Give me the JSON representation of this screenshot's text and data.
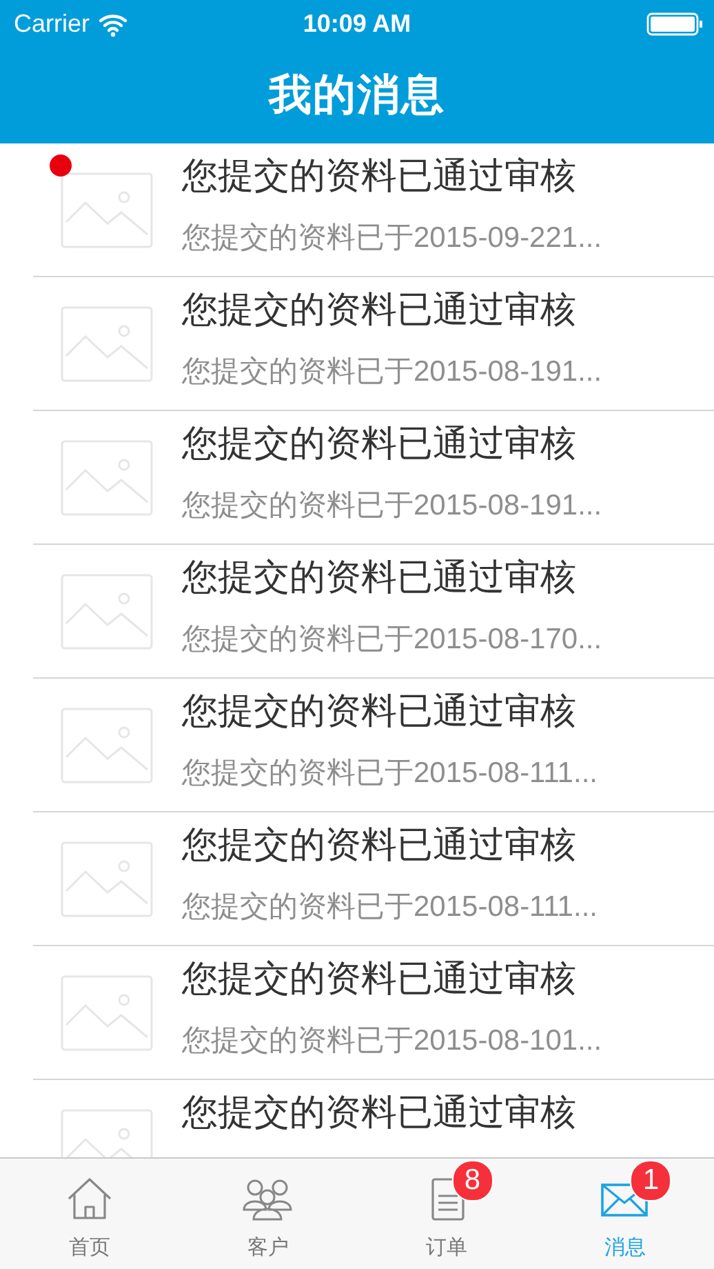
{
  "status_bar": {
    "carrier": "Carrier",
    "time": "10:09 AM"
  },
  "nav": {
    "title": "我的消息"
  },
  "messages": [
    {
      "title": "您提交的资料已通过审核",
      "preview": "您提交的资料已于2015-09-221...",
      "unread": true
    },
    {
      "title": "您提交的资料已通过审核",
      "preview": "您提交的资料已于2015-08-191...",
      "unread": false
    },
    {
      "title": "您提交的资料已通过审核",
      "preview": "您提交的资料已于2015-08-191...",
      "unread": false
    },
    {
      "title": "您提交的资料已通过审核",
      "preview": "您提交的资料已于2015-08-170...",
      "unread": false
    },
    {
      "title": "您提交的资料已通过审核",
      "preview": "您提交的资料已于2015-08-111...",
      "unread": false
    },
    {
      "title": "您提交的资料已通过审核",
      "preview": "您提交的资料已于2015-08-111...",
      "unread": false
    },
    {
      "title": "您提交的资料已通过审核",
      "preview": "您提交的资料已于2015-08-101...",
      "unread": false
    },
    {
      "title": "您提交的资料已通过审核",
      "unread": false
    }
  ],
  "tabs": [
    {
      "kind": "home",
      "label": "首页",
      "selected": false
    },
    {
      "kind": "customers",
      "label": "客户",
      "selected": false
    },
    {
      "kind": "orders",
      "label": "订单",
      "selected": false,
      "badge": "8"
    },
    {
      "kind": "messages",
      "label": "消息",
      "selected": true,
      "badge": "1"
    }
  ]
}
